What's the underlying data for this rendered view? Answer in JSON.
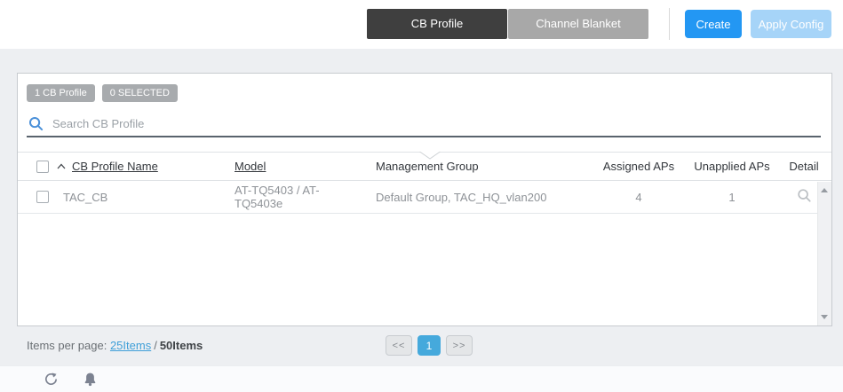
{
  "toolbar": {
    "tabs": [
      {
        "label": "CB Profile",
        "active": true
      },
      {
        "label": "Channel Blanket",
        "active": false
      }
    ],
    "create_label": "Create",
    "apply_config_label": "Apply Config"
  },
  "panel": {
    "badges": {
      "count_badge": "1 CB Profile",
      "selected_badge": "0 SELECTED"
    },
    "search": {
      "placeholder": "Search CB Profile"
    },
    "table": {
      "columns": {
        "name": "CB Profile Name",
        "model": "Model",
        "management_group": "Management Group",
        "assigned_aps": "Assigned APs",
        "unapplied_aps": "Unapplied APs",
        "detail": "Detail"
      },
      "sort": {
        "column": "CB Profile Name",
        "direction": "ascending"
      },
      "rows": [
        {
          "name": "TAC_CB",
          "model": "AT-TQ5403 / AT-TQ5403e",
          "management_group": "Default Group, TAC_HQ_vlan200",
          "assigned_aps": "4",
          "unapplied_aps": "1"
        }
      ]
    }
  },
  "footer": {
    "items_per_page_label": "Items per page:",
    "page_size_link": "25Items",
    "separator": "/",
    "total_label": "50Items",
    "pagination": {
      "prev": "<<",
      "current_page": "1",
      "next": ">>"
    }
  },
  "icons": {
    "search": "magnifier",
    "detail": "magnifier",
    "sort": "chevron-up",
    "refresh": "circular-arrow",
    "notifications": "bell"
  },
  "colors": {
    "accent_blue": "#2397f3",
    "disabled_blue": "#a6d4f8",
    "active_tab": "#3f3f3f",
    "inactive_tab": "#a8a8a8",
    "badge_gray": "#a8abae",
    "link_blue": "#3f9fd8",
    "pagination_active": "#45a9dc",
    "page_background": "#edeff2"
  }
}
